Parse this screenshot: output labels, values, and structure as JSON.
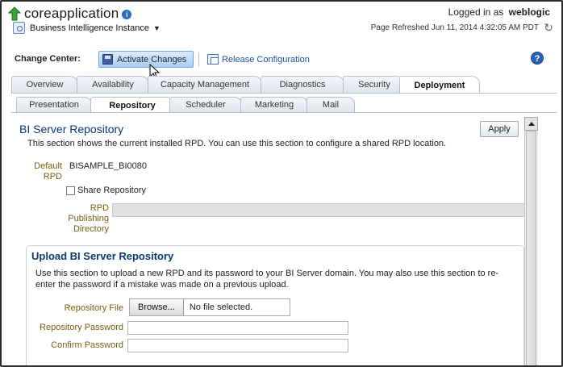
{
  "header": {
    "app_title": "coreapplication",
    "instance_label": "Business Intelligence Instance",
    "logged_in_prefix": "Logged in as",
    "logged_in_user": "weblogic",
    "page_refreshed": "Page Refreshed Jun 11, 2014 4:32:05 AM PDT"
  },
  "change_center": {
    "label": "Change Center:",
    "activate_label": "Activate Changes",
    "release_label": "Release Configuration"
  },
  "tabs": [
    {
      "label": "Overview"
    },
    {
      "label": "Availability"
    },
    {
      "label": "Capacity Management"
    },
    {
      "label": "Diagnostics"
    },
    {
      "label": "Security"
    },
    {
      "label": "Deployment"
    }
  ],
  "subtabs": [
    {
      "label": "Presentation"
    },
    {
      "label": "Repository"
    },
    {
      "label": "Scheduler"
    },
    {
      "label": "Marketing"
    },
    {
      "label": "Mail"
    }
  ],
  "repository": {
    "title": "BI Server Repository",
    "apply_label": "Apply",
    "description": "This section shows the current installed RPD. You can use this section to configure a shared RPD location.",
    "default_rpd_label_1": "Default",
    "default_rpd_label_2": "RPD",
    "default_rpd_value": "BISAMPLE_BI0080",
    "share_label": "Share Repository",
    "share_checked": false,
    "rpd_dir_label_1": "RPD",
    "rpd_dir_label_2": "Publishing",
    "rpd_dir_label_3": "Directory"
  },
  "upload": {
    "title": "Upload BI Server Repository",
    "description": "Use this section to upload a new RPD and its password to your BI Server domain. You may also use this section to re-enter the password if a mistake was made on a previous upload.",
    "file_label": "Repository File",
    "browse_label": "Browse...",
    "no_file_label": "No file selected.",
    "password_label": "Repository Password",
    "confirm_label": "Confirm Password"
  }
}
